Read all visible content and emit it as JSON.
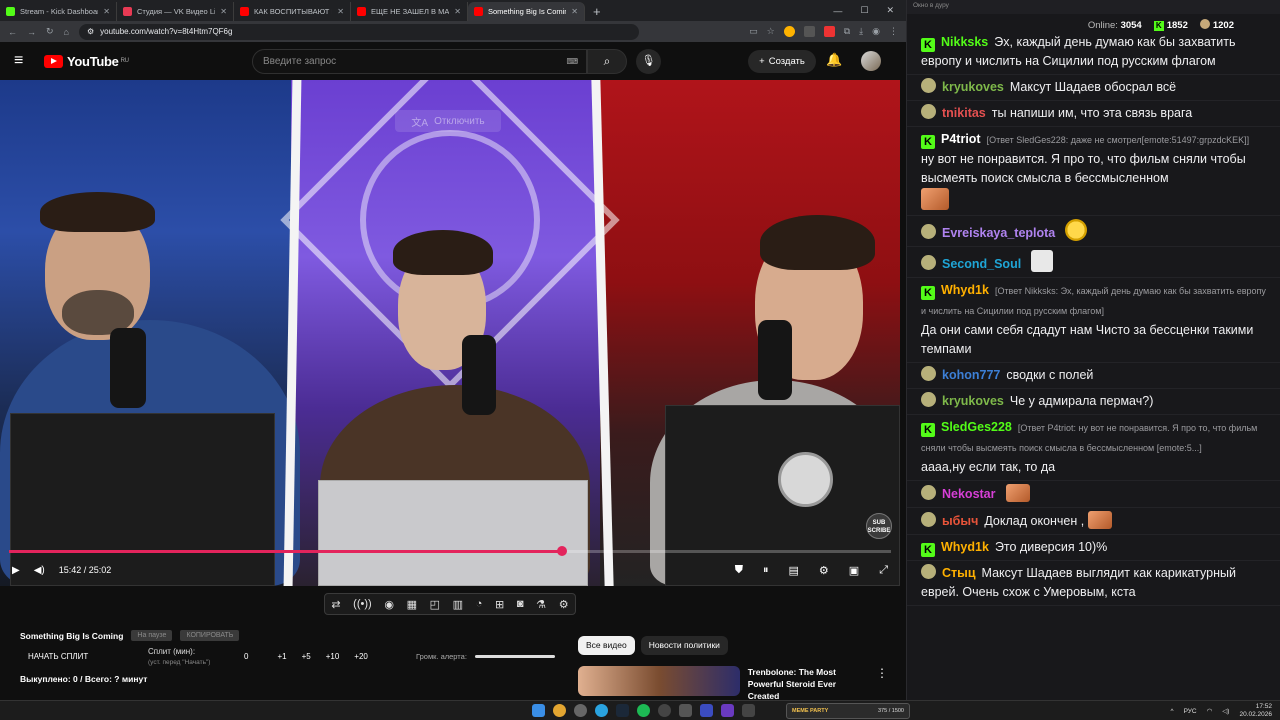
{
  "browser": {
    "tabs": [
      {
        "label": "Stream - Kick Dashboard",
        "color": "#53fc18"
      },
      {
        "label": "Студия — VK Видео Live",
        "color": "#e83a54"
      },
      {
        "label": "КАК ВОСПИТЫВАЮТ БРИТАН",
        "color": "#ff0000"
      },
      {
        "label": "ЕЩЕ НЕ ЗАШЕЛ В MAX, А ДАЛ",
        "color": "#ff0000"
      },
      {
        "label": "Something Big Is Coming - You",
        "color": "#ff0000"
      }
    ],
    "url": "youtube.com/watch?v=8t4Htm7QF6g"
  },
  "youtube": {
    "logo": "YouTube",
    "region": "RU",
    "search_placeholder": "Введите запрос",
    "create_label": "Создать",
    "cc_overlay": "Отключить",
    "time": "15:42 / 25:02",
    "progress_fraction": 0.627,
    "subscribe_badge": "SUB SCRIBE",
    "video_title": "Something Big Is Coming",
    "pill_1": "На паузе",
    "pill_2": "КОПИРОВАТЬ",
    "split_button": "НАЧАТЬ СПЛИТ",
    "split_label": "Сплит (мин):",
    "split_hint": "(уст. перед \"Начать\")",
    "split_values": [
      "0",
      "+1",
      "+5",
      "+10",
      "+20"
    ],
    "alert_label": "Громк. алерта:",
    "bought": "Выкуплено: 0 / Всего: ? минут",
    "chips": [
      "Все видео",
      "Новости политики"
    ],
    "rec_title": "Trenbolone: The Most Powerful Steroid Ever Created"
  },
  "chat": {
    "window_title": "Окно в дуру",
    "online_label": "Online:",
    "online": "3054",
    "kick_count": "1852",
    "other_count": "1202",
    "messages": [
      {
        "user": "Nikksks",
        "color": "#53fc18",
        "badge": "k",
        "text": "Эх, каждый день думаю как бы захватить европу и числить на Сицилии под русским флагом"
      },
      {
        "user": "kryukoves",
        "color": "#7eb84a",
        "badge": "h",
        "text": "Максут Шадаев обосрал всё"
      },
      {
        "user": "tnikitas",
        "color": "#e45050",
        "badge": "h",
        "text": "ты напиши им, что эта связь врага"
      },
      {
        "user": "P4triot",
        "color": "#ffffff",
        "badge": "k",
        "reply": "[Ответ SledGes228: даже не смотрел[emote:51497:grpzdcKEK]]",
        "text": "ну вот не понравится. Я про то, что фильм сняли чтобы высмеять поиск смысла в бессмысленном"
      },
      {
        "user": "Evreiskaya_teplota",
        "color": "#b083f0",
        "badge": "h",
        "text": ""
      },
      {
        "user": "Second_Soul",
        "color": "#1fa5d6",
        "badge": "h",
        "text": ""
      },
      {
        "user": "Whyd1k",
        "color": "#ffb000",
        "badge": "k",
        "reply": "[Ответ Nikksks: Эх, каждый день думаю как бы захватить европу и числить на Сицилии под русским флагом]",
        "text": "Да они сами себя сдадут нам Чисто за бессценки такими темпами"
      },
      {
        "user": "kohon777",
        "color": "#3c7fd6",
        "badge": "h",
        "text": "сводки с полей"
      },
      {
        "user": "kryukoves",
        "color": "#7eb84a",
        "badge": "h",
        "text": "Че у адмирала пермач?)"
      },
      {
        "user": "SledGes228",
        "color": "#53fc18",
        "badge": "k",
        "reply": "[Ответ P4triot: ну вот не понравится. Я про то, что фильм сняли чтобы высмеять поиск смысла в бессмысленном [emote:5...]",
        "text": "аааа,ну если так, то да"
      },
      {
        "user": "Nekostar",
        "color": "#d63fd6",
        "badge": "h",
        "text": ""
      },
      {
        "user": "ыбыч",
        "color": "#e8543a",
        "badge": "h",
        "text": "Доклад окончен ,"
      },
      {
        "user": "Whyd1k",
        "color": "#ffb000",
        "badge": "k",
        "text": "Это диверсия 10)%"
      },
      {
        "user": "Стыц",
        "color": "#ffb000",
        "badge": "h",
        "text": "Максут Шадаев выглядит как карикатурный еврей. Очень схож с Умеровым, кста"
      }
    ]
  },
  "taskbar": {
    "meme_label": "MEME PARTY",
    "meme_counter": "375 / 1500",
    "lang": "РУС",
    "time": "17:52",
    "date": "20.02.2026"
  }
}
